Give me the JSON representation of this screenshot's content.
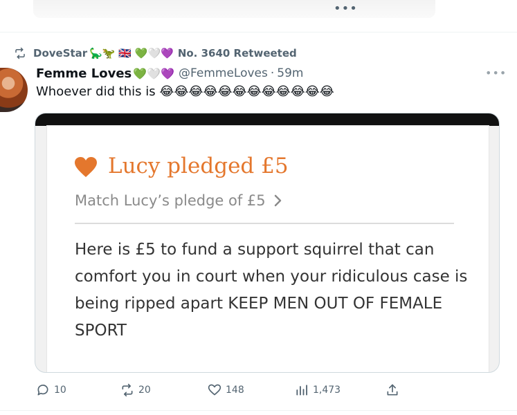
{
  "previous_tweet": {
    "more_label": "•••"
  },
  "retweet_bar": {
    "retweeter_name": "DoveStar",
    "retweeter_emojis": "🦕🦖 🇬🇧 💚🤍💜",
    "suffix": "No. 3640 Retweeted"
  },
  "tweet": {
    "author_name": "Femme Loves",
    "author_emojis": "💚🤍💜",
    "author_handle": "@FemmeLoves",
    "separator": "·",
    "time_ago": "59m",
    "more_label": "•••",
    "text": "Whoever did this is 😂😂😂😂😂😂😂😂😂😂😂😂"
  },
  "media": {
    "pledge_title": "Lucy pledged £5",
    "match_text": "Match Lucy’s pledge of £5",
    "message": "Here is £5 to fund a support squirrel that can comfort you in court when your ridiculous case is being ripped apart KEEP MEN OUT OF FEMALE SPORT"
  },
  "actions": {
    "replies": "10",
    "retweets": "20",
    "likes": "148",
    "views": "1,473"
  },
  "colors": {
    "accent_orange": "#e4772d",
    "secondary_text": "#536471"
  }
}
